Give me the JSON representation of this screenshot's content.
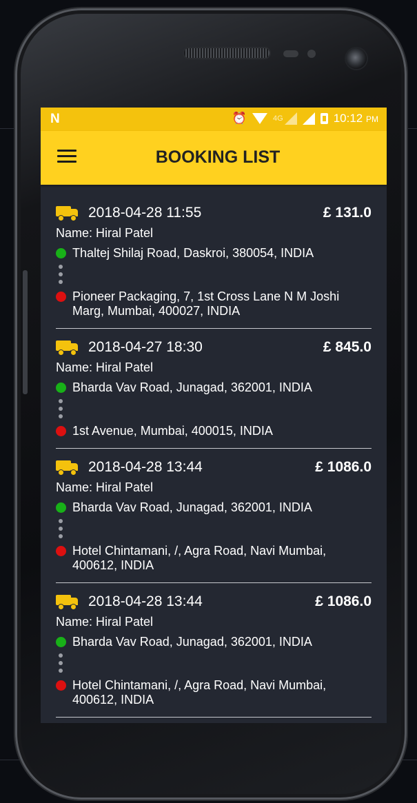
{
  "statusbar": {
    "time": "10:12",
    "ampm": "PM",
    "network": "4G"
  },
  "appbar": {
    "title": "BOOKING LIST"
  },
  "bookings": [
    {
      "datetime": "2018-04-28 11:55",
      "price": "£ 131.0",
      "name": "Name: Hiral Patel",
      "pickup": "Thaltej Shilaj Road, Daskroi, 380054, INDIA",
      "drop": "Pioneer Packaging, 7, 1st Cross Lane N M Joshi Marg, Mumbai, 400027, INDIA"
    },
    {
      "datetime": "2018-04-27 18:30",
      "price": "£ 845.0",
      "name": "Name: Hiral Patel",
      "pickup": "Bharda Vav Road, Junagad, 362001, INDIA",
      "drop": "1st Avenue, Mumbai, 400015, INDIA"
    },
    {
      "datetime": "2018-04-28 13:44",
      "price": "£ 1086.0",
      "name": "Name: Hiral Patel",
      "pickup": "Bharda Vav Road, Junagad, 362001, INDIA",
      "drop": "Hotel Chintamani, /, Agra Road, Navi Mumbai, 400612, INDIA"
    },
    {
      "datetime": "2018-04-28 13:44",
      "price": "£ 1086.0",
      "name": "Name: Hiral Patel",
      "pickup": "Bharda Vav Road, Junagad, 362001, INDIA",
      "drop": "Hotel Chintamani, /, Agra Road, Navi Mumbai, 400612, INDIA"
    }
  ],
  "colors": {
    "accent": "#ffd11f",
    "status": "#f4c20d",
    "background": "#242832",
    "pickup_dot": "#18b018",
    "drop_dot": "#dc1010"
  }
}
